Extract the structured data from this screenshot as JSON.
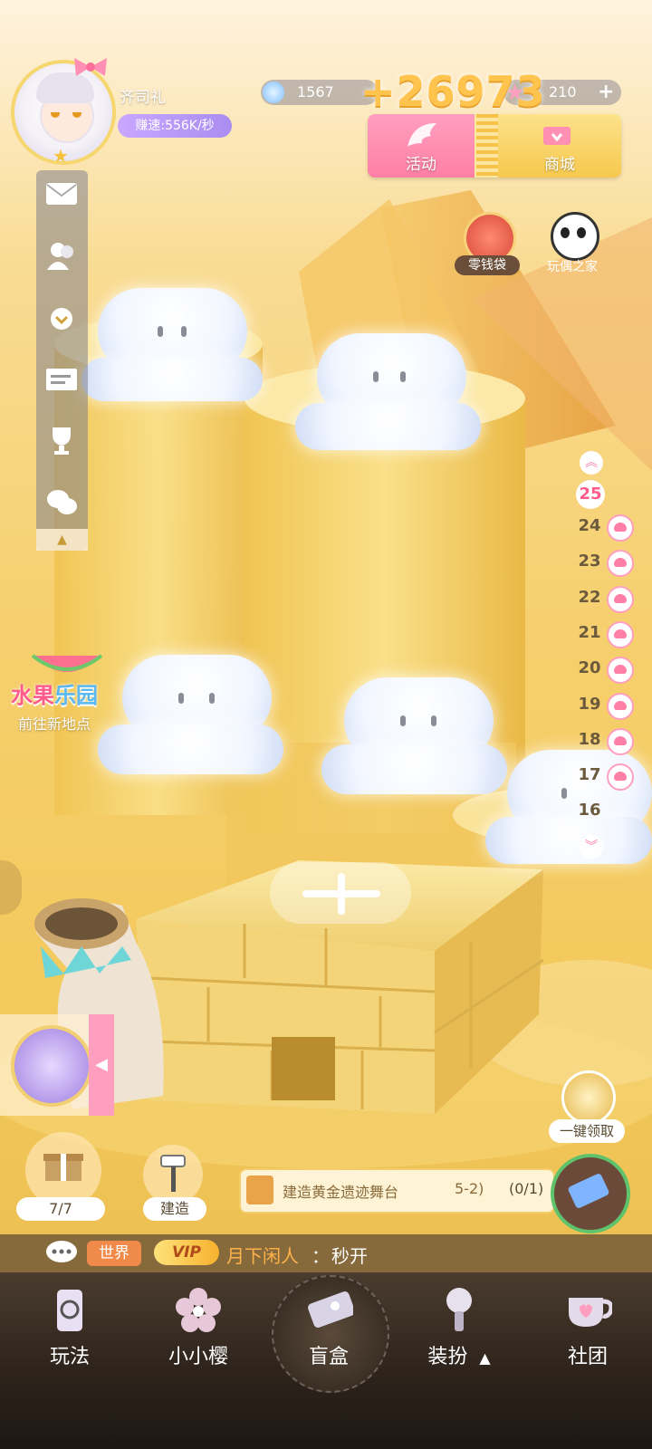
{
  "player": {
    "name": "齐司礼",
    "speed": "赚速:556K/秒"
  },
  "resources": {
    "diamond": "1567",
    "gain": "+26973",
    "star": "210",
    "plus": "+"
  },
  "top_buttons": {
    "activity": "活动",
    "shop": "商城"
  },
  "side_shortcuts": {
    "coin_bag": "零钱袋",
    "doll_house": "玩偶之家"
  },
  "location": {
    "logo_part1": "水果",
    "logo_part2": "乐园",
    "goto": "前往新地点"
  },
  "levels": {
    "current": "25",
    "list": [
      "24",
      "23",
      "22",
      "21",
      "20",
      "19",
      "18",
      "17",
      "16"
    ]
  },
  "actions": {
    "gift_count": "7/7",
    "build": "建造",
    "claim_all": "一键领取"
  },
  "task": {
    "text": "建造黄金遗迹舞台",
    "stage": "5-2)",
    "progress": "(0/1)"
  },
  "chat": {
    "channel": "世界",
    "vip": "VIP",
    "user": "月下闲人",
    "sep": "：",
    "message": "秒开"
  },
  "nav": {
    "items": [
      "玩法",
      "小小樱",
      "盲盒",
      "装扮",
      "社团"
    ],
    "expand": "▲"
  },
  "colors": {
    "accent_pink": "#ff7fa6",
    "gold": "#f6c84e",
    "purple": "#a98df0"
  }
}
